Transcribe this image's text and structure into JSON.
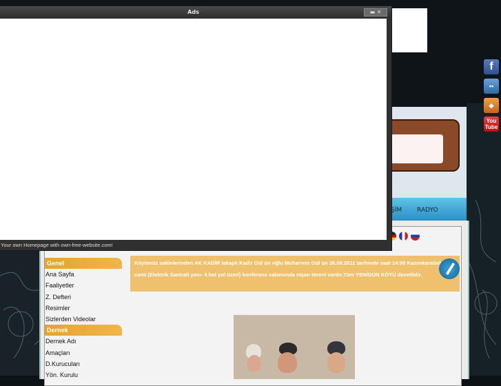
{
  "ads_window": {
    "title": "Ads",
    "window_buttons": "▬ ✕",
    "footer": "Your own Homepage with own-free-website.com!"
  },
  "nav": {
    "item_1": "ŞİM",
    "item_2": "RADYO"
  },
  "social": {
    "facebook": "f",
    "myspace": "▪▪",
    "windows_live": "◆",
    "youtube_line1": "You",
    "youtube_line2": "Tube"
  },
  "sidebar": {
    "section_1": "Genel",
    "items_1": [
      "Ana Sayfa",
      "Faaliyetler",
      "Z. Defteri",
      "Resimler",
      "Sizlerden Videolar"
    ],
    "section_2": "Dernek",
    "items_2": [
      "Dernek Adı",
      "Amaçları",
      "D.Kurucuları",
      "Yön. Kurulu"
    ]
  },
  "notice": {
    "text": "Köyümüz sakinlerinden AK KADİR lakaplı Kadir Gül ün oğlu Muharrem Gül ün 26.06.2011 tarihinde saat 14:00 Kazımkarabekir cami (Elektrik Santrali yanı- 4.hat yol üzeri) konferans salonunda nişan töreni vardır.Tüm YENİGÜN KÖYÜ davetlidir."
  },
  "colors": {
    "accent_orange": "#e8a230",
    "nav_blue": "#2b8fc4",
    "ads_chrome": "#303030",
    "flags": [
      "#e03020",
      "#f0c020",
      "#2050c0",
      "#d03030"
    ]
  }
}
